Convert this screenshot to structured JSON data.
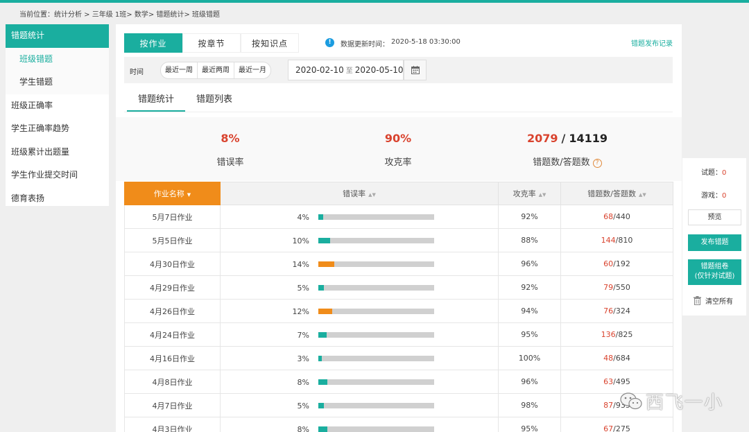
{
  "breadcrumb": "当前位置：统计分析 > 三年级 1班> 数学> 错题统计> 班级错题",
  "sidebar": {
    "items": [
      {
        "label": "错题统计",
        "kind": "section-active"
      },
      {
        "label": "班级错题",
        "kind": "sub-current"
      },
      {
        "label": "学生错题",
        "kind": "sub"
      },
      {
        "label": "班级正确率",
        "kind": "item"
      },
      {
        "label": "学生正确率趋势",
        "kind": "item"
      },
      {
        "label": "班级累计出题量",
        "kind": "item"
      },
      {
        "label": "学生作业提交时间",
        "kind": "item"
      },
      {
        "label": "德育表扬",
        "kind": "item"
      }
    ]
  },
  "tabs": [
    "按作业",
    "按章节",
    "按知识点"
  ],
  "info_icon_glyph": "!",
  "update": {
    "label": "数据更新时间：",
    "time": "2020-5-18    03:30:00"
  },
  "publish_link": "错题发布记录",
  "filter": {
    "time_label": "时间",
    "quick": [
      "最近一周",
      "最近两周",
      "最近一月"
    ],
    "date_start": "2020-02-10",
    "date_sep": "至",
    "date_end": "2020-05-10"
  },
  "subtabs": [
    "错题统计",
    "错题列表"
  ],
  "stats": {
    "error_rate": {
      "value": "8%",
      "label": "错误率"
    },
    "conquer_rate": {
      "value": "90%",
      "label": "攻克率"
    },
    "counts": {
      "wrong": "2079",
      "slash": "/",
      "total": "14119",
      "label": "错题数/答题数",
      "help": "?"
    }
  },
  "table": {
    "headers": {
      "name": "作业名称",
      "error_rate": "错误率",
      "conquer_rate": "攻克率",
      "counts": "错题数/答题数"
    },
    "sort_glyph": "▲▼",
    "caret_glyph": "▼",
    "rows": [
      {
        "name": "5月7日作业",
        "error_rate": "4%",
        "error_value": 4,
        "bar": "green",
        "conquer_rate": "92%",
        "wrong": "68",
        "total": "/440"
      },
      {
        "name": "5月5日作业",
        "error_rate": "10%",
        "error_value": 10,
        "bar": "green",
        "conquer_rate": "88%",
        "wrong": "144",
        "total": "/810"
      },
      {
        "name": "4月30日作业",
        "error_rate": "14%",
        "error_value": 14,
        "bar": "orange",
        "conquer_rate": "96%",
        "wrong": "60",
        "total": "/192"
      },
      {
        "name": "4月29日作业",
        "error_rate": "5%",
        "error_value": 5,
        "bar": "green",
        "conquer_rate": "92%",
        "wrong": "79",
        "total": "/550"
      },
      {
        "name": "4月26日作业",
        "error_rate": "12%",
        "error_value": 12,
        "bar": "orange",
        "conquer_rate": "94%",
        "wrong": "76",
        "total": "/324"
      },
      {
        "name": "4月24日作业",
        "error_rate": "7%",
        "error_value": 7,
        "bar": "green",
        "conquer_rate": "95%",
        "wrong": "136",
        "total": "/825"
      },
      {
        "name": "4月16日作业",
        "error_rate": "3%",
        "error_value": 3,
        "bar": "green",
        "conquer_rate": "100%",
        "wrong": "48",
        "total": "/684"
      },
      {
        "name": "4月8日作业",
        "error_rate": "8%",
        "error_value": 8,
        "bar": "green",
        "conquer_rate": "96%",
        "wrong": "63",
        "total": "/495"
      },
      {
        "name": "4月7日作业",
        "error_rate": "5%",
        "error_value": 5,
        "bar": "green",
        "conquer_rate": "98%",
        "wrong": "87",
        "total": "/935"
      },
      {
        "name": "4月3日作业",
        "error_rate": "8%",
        "error_value": 8,
        "bar": "green",
        "conquer_rate": "95%",
        "wrong": "67",
        "total": "/275"
      }
    ]
  },
  "right_panel": {
    "questions_label": "试题：",
    "questions_count": "0",
    "games_label": "游戏：",
    "games_count": "0",
    "preview": "预览",
    "publish": "发布错题",
    "compose_line1": "错题组卷",
    "compose_line2": "(仅针对试题)",
    "clear": "清空所有"
  },
  "watermark": "西飞一小",
  "colors": {
    "accent": "#1aae9f",
    "orange": "#f08c1a",
    "red": "#d9432e",
    "bar_track": "#d0d0d0"
  }
}
